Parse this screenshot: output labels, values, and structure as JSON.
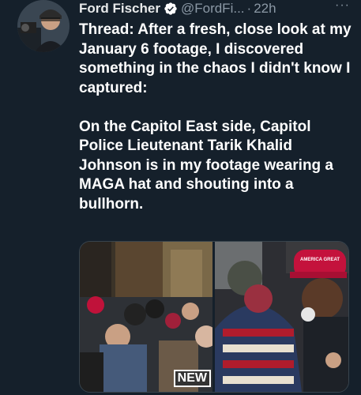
{
  "tweet": {
    "author_name": "Ford Fischer",
    "handle": "@FordFi...",
    "separator": "·",
    "time": "22h",
    "more_label": "···",
    "text": "Thread: After a fresh, close look at my January 6 footage, I discovered something in the chaos I didn't know I captured:\n\nOn the Capitol East side, Capitol Police Lieutenant Tarik Khalid Johnson is in my footage wearing a MAGA hat and shouting into a bullhorn.",
    "media": {
      "left_badge": "NEW",
      "right_hat_text": "AMERICA GREAT"
    }
  },
  "colors": {
    "background": "#15202b",
    "verified": "#1d9bf0",
    "secondary_text": "#8b98a5"
  }
}
